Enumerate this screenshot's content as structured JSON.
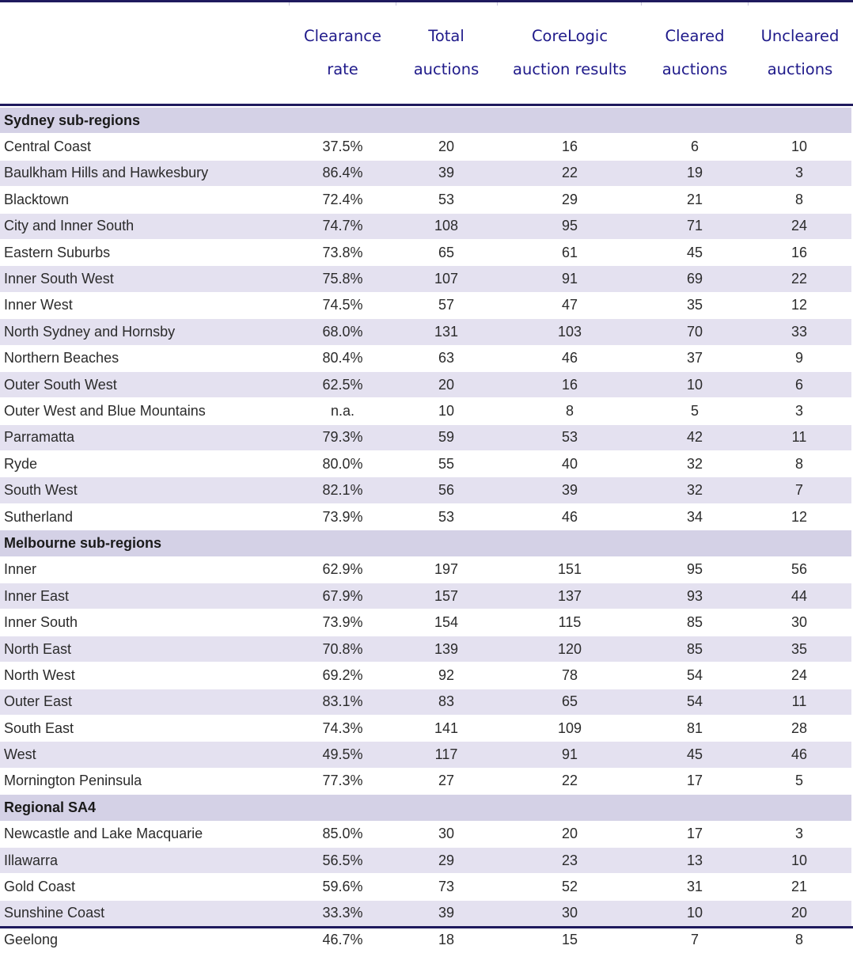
{
  "header": {
    "columns": [
      {
        "line1": "Clearance",
        "line2": "rate"
      },
      {
        "line1": "Total",
        "line2": "auctions"
      },
      {
        "line1": "CoreLogic",
        "line2": "auction results"
      },
      {
        "line1": "Cleared",
        "line2": "auctions"
      },
      {
        "line1": "Uncleared",
        "line2": "auctions"
      }
    ]
  },
  "sections": [
    {
      "title": "Sydney sub-regions",
      "rows": [
        {
          "name": "Central Coast",
          "rate": "37.5%",
          "total": "20",
          "results": "16",
          "cleared": "6",
          "uncleared": "10"
        },
        {
          "name": "Baulkham Hills and Hawkesbury",
          "rate": "86.4%",
          "total": "39",
          "results": "22",
          "cleared": "19",
          "uncleared": "3"
        },
        {
          "name": "Blacktown",
          "rate": "72.4%",
          "total": "53",
          "results": "29",
          "cleared": "21",
          "uncleared": "8"
        },
        {
          "name": "City and Inner South",
          "rate": "74.7%",
          "total": "108",
          "results": "95",
          "cleared": "71",
          "uncleared": "24"
        },
        {
          "name": "Eastern Suburbs",
          "rate": "73.8%",
          "total": "65",
          "results": "61",
          "cleared": "45",
          "uncleared": "16"
        },
        {
          "name": "Inner South West",
          "rate": "75.8%",
          "total": "107",
          "results": "91",
          "cleared": "69",
          "uncleared": "22"
        },
        {
          "name": "Inner West",
          "rate": "74.5%",
          "total": "57",
          "results": "47",
          "cleared": "35",
          "uncleared": "12"
        },
        {
          "name": "North Sydney and Hornsby",
          "rate": "68.0%",
          "total": "131",
          "results": "103",
          "cleared": "70",
          "uncleared": "33"
        },
        {
          "name": "Northern Beaches",
          "rate": "80.4%",
          "total": "63",
          "results": "46",
          "cleared": "37",
          "uncleared": "9"
        },
        {
          "name": "Outer South West",
          "rate": "62.5%",
          "total": "20",
          "results": "16",
          "cleared": "10",
          "uncleared": "6"
        },
        {
          "name": "Outer West and Blue Mountains",
          "rate": "n.a.",
          "total": "10",
          "results": "8",
          "cleared": "5",
          "uncleared": "3"
        },
        {
          "name": "Parramatta",
          "rate": "79.3%",
          "total": "59",
          "results": "53",
          "cleared": "42",
          "uncleared": "11"
        },
        {
          "name": "Ryde",
          "rate": "80.0%",
          "total": "55",
          "results": "40",
          "cleared": "32",
          "uncleared": "8"
        },
        {
          "name": "South West",
          "rate": "82.1%",
          "total": "56",
          "results": "39",
          "cleared": "32",
          "uncleared": "7"
        },
        {
          "name": "Sutherland",
          "rate": "73.9%",
          "total": "53",
          "results": "46",
          "cleared": "34",
          "uncleared": "12"
        }
      ]
    },
    {
      "title": "Melbourne sub-regions",
      "rows": [
        {
          "name": "Inner",
          "rate": "62.9%",
          "total": "197",
          "results": "151",
          "cleared": "95",
          "uncleared": "56"
        },
        {
          "name": "Inner East",
          "rate": "67.9%",
          "total": "157",
          "results": "137",
          "cleared": "93",
          "uncleared": "44"
        },
        {
          "name": "Inner South",
          "rate": "73.9%",
          "total": "154",
          "results": "115",
          "cleared": "85",
          "uncleared": "30"
        },
        {
          "name": "North East",
          "rate": "70.8%",
          "total": "139",
          "results": "120",
          "cleared": "85",
          "uncleared": "35"
        },
        {
          "name": "North West",
          "rate": "69.2%",
          "total": "92",
          "results": "78",
          "cleared": "54",
          "uncleared": "24"
        },
        {
          "name": "Outer East",
          "rate": "83.1%",
          "total": "83",
          "results": "65",
          "cleared": "54",
          "uncleared": "11"
        },
        {
          "name": "South East",
          "rate": "74.3%",
          "total": "141",
          "results": "109",
          "cleared": "81",
          "uncleared": "28"
        },
        {
          "name": "West",
          "rate": "49.5%",
          "total": "117",
          "results": "91",
          "cleared": "45",
          "uncleared": "46"
        },
        {
          "name": "Mornington Peninsula",
          "rate": "77.3%",
          "total": "27",
          "results": "22",
          "cleared": "17",
          "uncleared": "5"
        }
      ]
    },
    {
      "title": "Regional SA4",
      "rows": [
        {
          "name": "Newcastle and Lake Macquarie",
          "rate": "85.0%",
          "total": "30",
          "results": "20",
          "cleared": "17",
          "uncleared": "3"
        },
        {
          "name": "Illawarra",
          "rate": "56.5%",
          "total": "29",
          "results": "23",
          "cleared": "13",
          "uncleared": "10"
        },
        {
          "name": "Gold Coast",
          "rate": "59.6%",
          "total": "73",
          "results": "52",
          "cleared": "31",
          "uncleared": "21"
        },
        {
          "name": "Sunshine Coast",
          "rate": "33.3%",
          "total": "39",
          "results": "30",
          "cleared": "10",
          "uncleared": "20"
        },
        {
          "name": "Geelong",
          "rate": "46.7%",
          "total": "18",
          "results": "15",
          "cleared": "7",
          "uncleared": "8"
        }
      ]
    }
  ],
  "colors": {
    "rule": "#1f1a5e",
    "header_text": "#1f1a8a",
    "section_bg": "#d4d1e6",
    "stripe_bg": "#e4e1f0"
  }
}
